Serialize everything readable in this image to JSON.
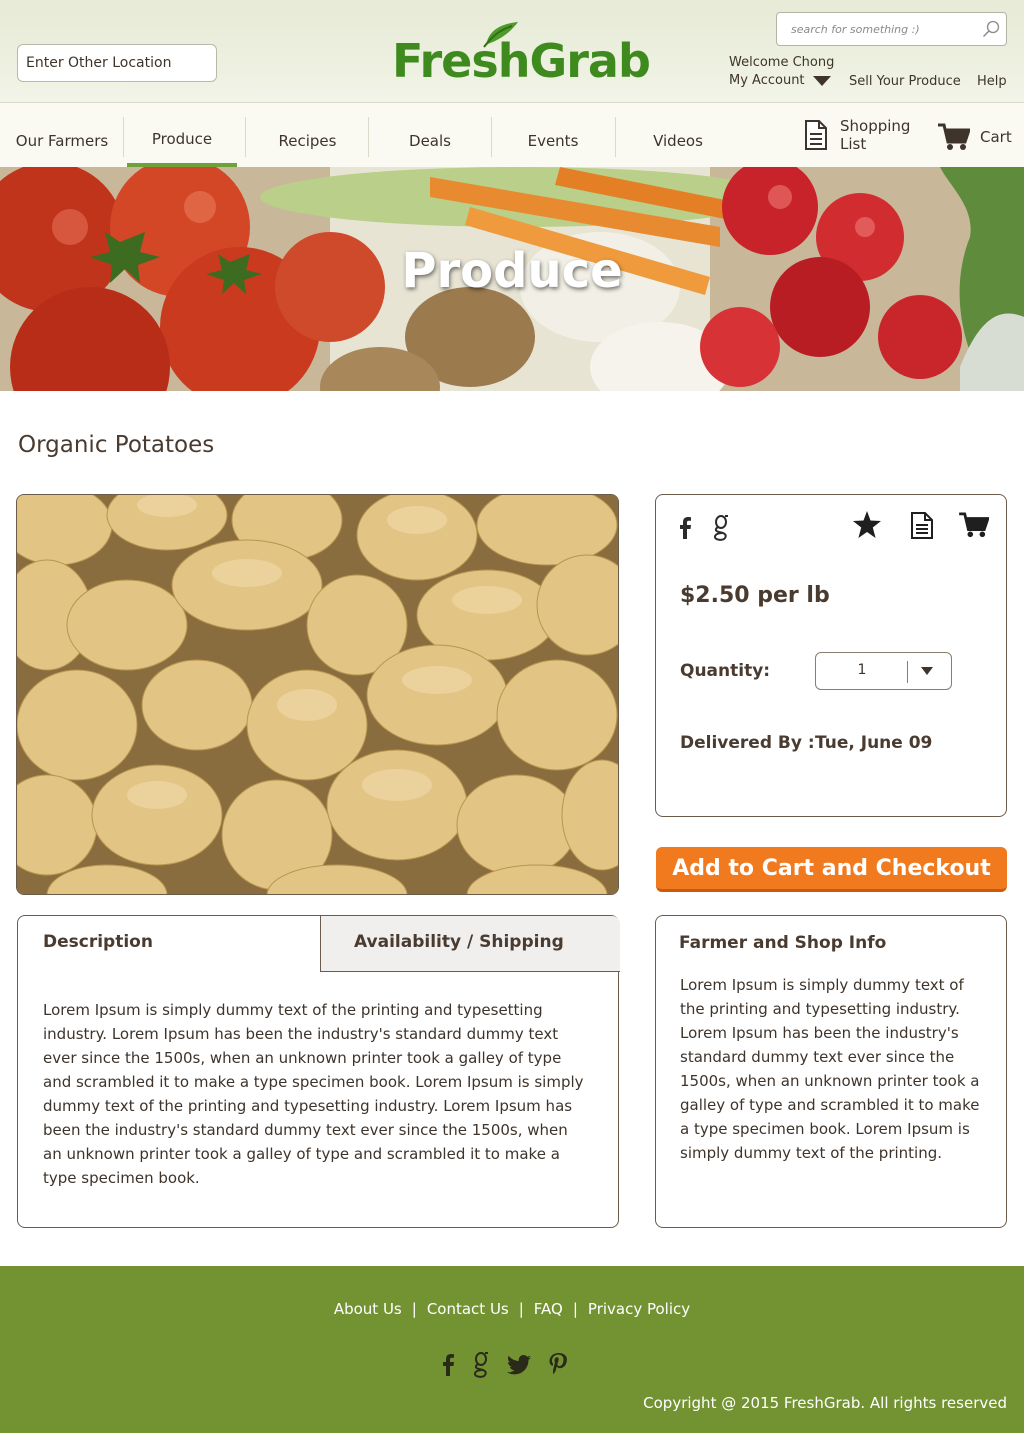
{
  "header": {
    "location_label": "Enter Other Location",
    "brand": "FreshGrab",
    "search_placeholder": "search for something :)",
    "welcome": "Welcome Chong",
    "my_account": "My Account",
    "sell": "Sell Your Produce",
    "help": "Help"
  },
  "nav": {
    "items": [
      {
        "label": "Our Farmers"
      },
      {
        "label": "Produce",
        "active": true
      },
      {
        "label": "Recipes"
      },
      {
        "label": "Deals"
      },
      {
        "label": "Events"
      },
      {
        "label": "Videos"
      }
    ],
    "shopping_list_line1": "Shopping",
    "shopping_list_line2": "List",
    "cart": "Cart"
  },
  "banner": {
    "title": "Produce"
  },
  "product": {
    "title": "Organic Potatoes",
    "price": "$2.50 per lb",
    "quantity_label": "Quantity:",
    "quantity_value": "1",
    "delivered_label": "Delivered By :",
    "delivered_value": "Tue, June 09",
    "checkout": "Add to Cart and Checkout",
    "icons": [
      "facebook-icon",
      "google-icon",
      "star-icon",
      "document-icon",
      "cart-icon"
    ]
  },
  "tabs": {
    "description": "Description",
    "availability": "Availability / Shipping",
    "active": "Description",
    "content": "Lorem Ipsum is simply dummy text of the printing and typesetting industry. Lorem Ipsum has been the industry's standard dummy text ever since the 1500s, when an unknown printer took a galley of type and scrambled it to make a type specimen book. Lorem Ipsum is simply dummy text of the printing and typesetting industry. Lorem Ipsum has been the industry's standard dummy text ever since the 1500s, when an unknown printer took a galley of type and scrambled it to make a type specimen book."
  },
  "farmer": {
    "title": "Farmer and Shop Info",
    "content": "Lorem Ipsum is simply dummy text of the printing and typesetting industry. Lorem Ipsum has been the industry's standard dummy text ever since the 1500s, when an unknown printer took a galley of type and scrambled it to make a type specimen book. Lorem Ipsum is simply dummy text of the printing."
  },
  "footer": {
    "links": [
      "About Us",
      "Contact Us",
      "FAQ",
      "Privacy Policy"
    ],
    "social": [
      "facebook-icon",
      "google-icon",
      "twitter-icon",
      "pinterest-icon"
    ],
    "copyright": "Copyright @ 2015 FreshGrab. All rights reserved"
  },
  "colors": {
    "brand_green": "#3f8a1f",
    "accent_orange": "#f17a1f",
    "footer_green": "#739333",
    "nav_active_underline": "#6ea13a",
    "text_brown": "#4a3b30"
  }
}
